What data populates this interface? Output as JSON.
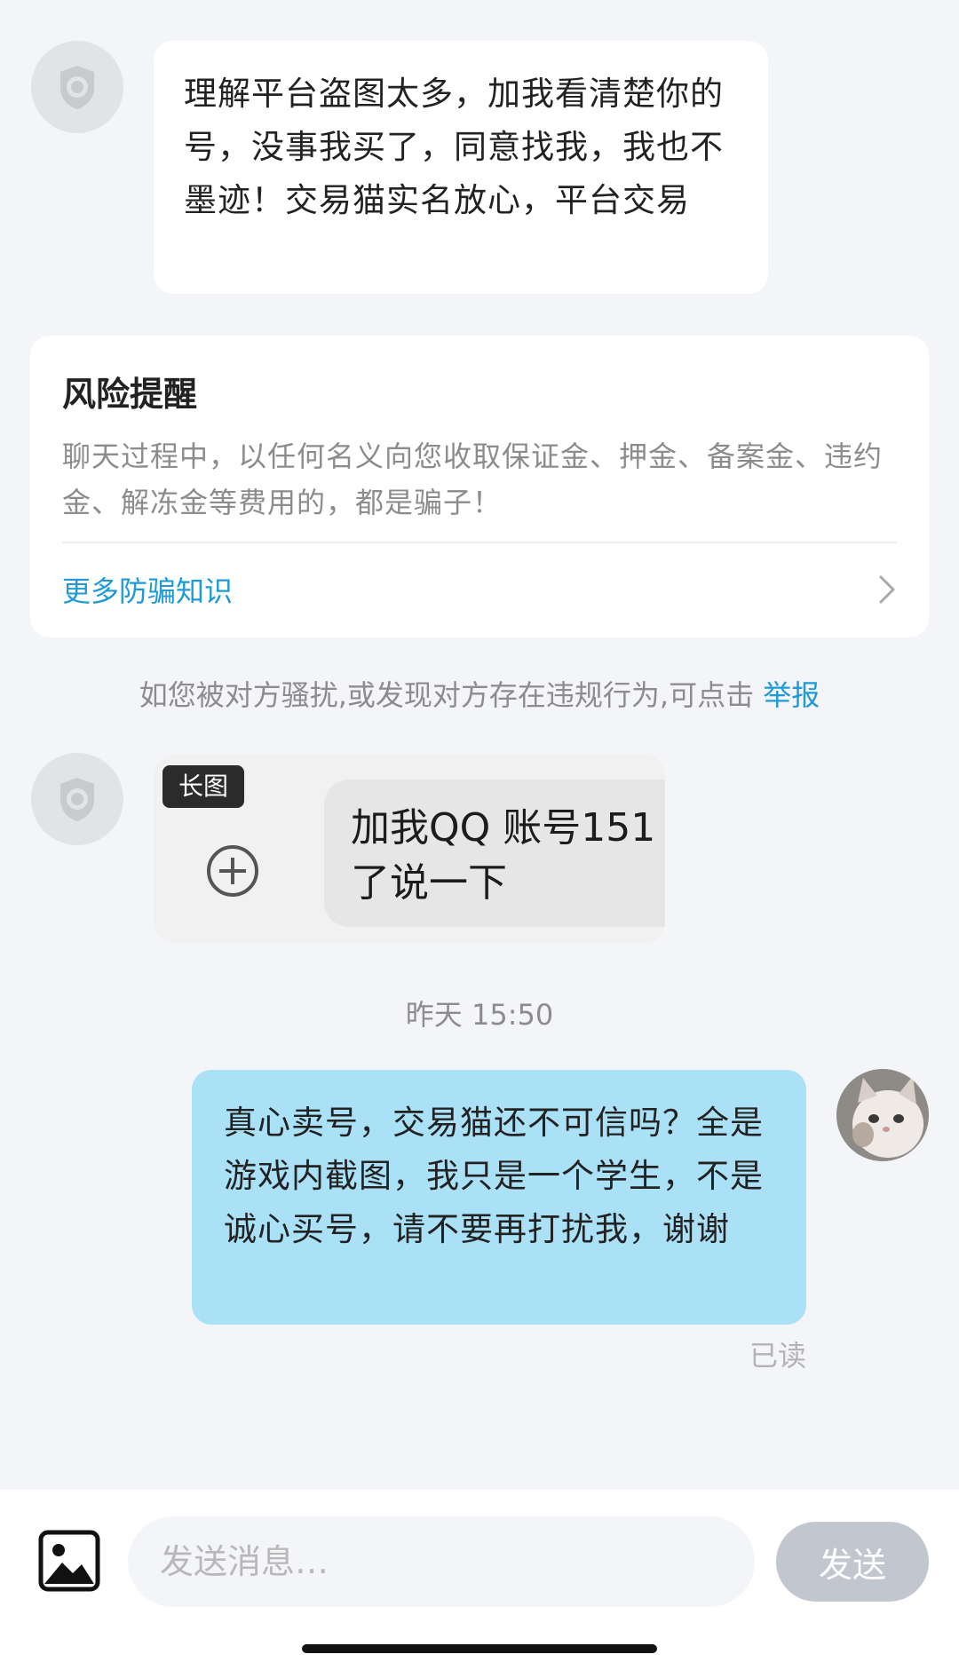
{
  "messages": {
    "incoming_text": "理解平台盗图太多，加我看清楚你的号，没事我买了，同意找我，我也不墨迹！交易猫实名放心，平台交易",
    "image_badge": "长图",
    "image_text_line1": "加我QQ 账号151",
    "image_text_line2": "了说一下",
    "timestamp": "昨天 15:50",
    "outgoing_text": "真心卖号，交易猫还不可信吗？全是游戏内截图，我只是一个学生，不是诚心买号，请不要再打扰我，谢谢",
    "read_status": "已读"
  },
  "risk_card": {
    "title": "风险提醒",
    "body": "聊天过程中，以任何名义向您收取保证金、押金、备案金、违约金、解冻金等费用的，都是骗子！",
    "link_label": "更多防骗知识"
  },
  "report": {
    "notice_text": "如您被对方骚扰,或发现对方存在违规行为,可点击 ",
    "link_label": "举报"
  },
  "composer": {
    "placeholder": "发送消息…",
    "send_label": "发送"
  },
  "colors": {
    "accent": "#1e9ad6",
    "outgoing_bubble": "#aae1f7",
    "send_button_disabled": "#c2c6cf",
    "page_background": "#f4f5f9"
  },
  "icons": {
    "contact_avatar": "default-avatar-icon",
    "chevron": "chevron-right-icon",
    "image_picker": "image-icon",
    "plus": "plus-circle-icon"
  }
}
